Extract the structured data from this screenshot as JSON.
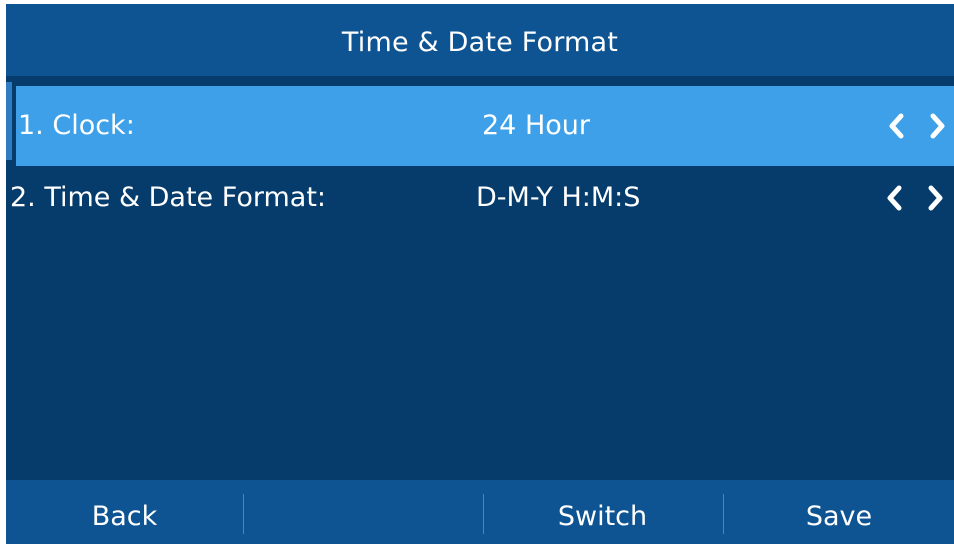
{
  "title": "Time & Date Format",
  "rows": [
    {
      "label": "1.  Clock:",
      "value": "24 Hour",
      "selected": true
    },
    {
      "label": "2.  Time & Date Format:",
      "value": "D-M-Y H:M:S",
      "selected": false
    }
  ],
  "softkeys": [
    "Back",
    "",
    "Switch",
    "Save"
  ],
  "icons": {
    "prev": "chevron-left-icon",
    "next": "chevron-right-icon"
  },
  "colors": {
    "title_bar": "#0f5492",
    "content": "#063c6c",
    "selected_row": "#3da0e8",
    "softkey_bar": "#0f5492",
    "text": "#ffffff"
  }
}
